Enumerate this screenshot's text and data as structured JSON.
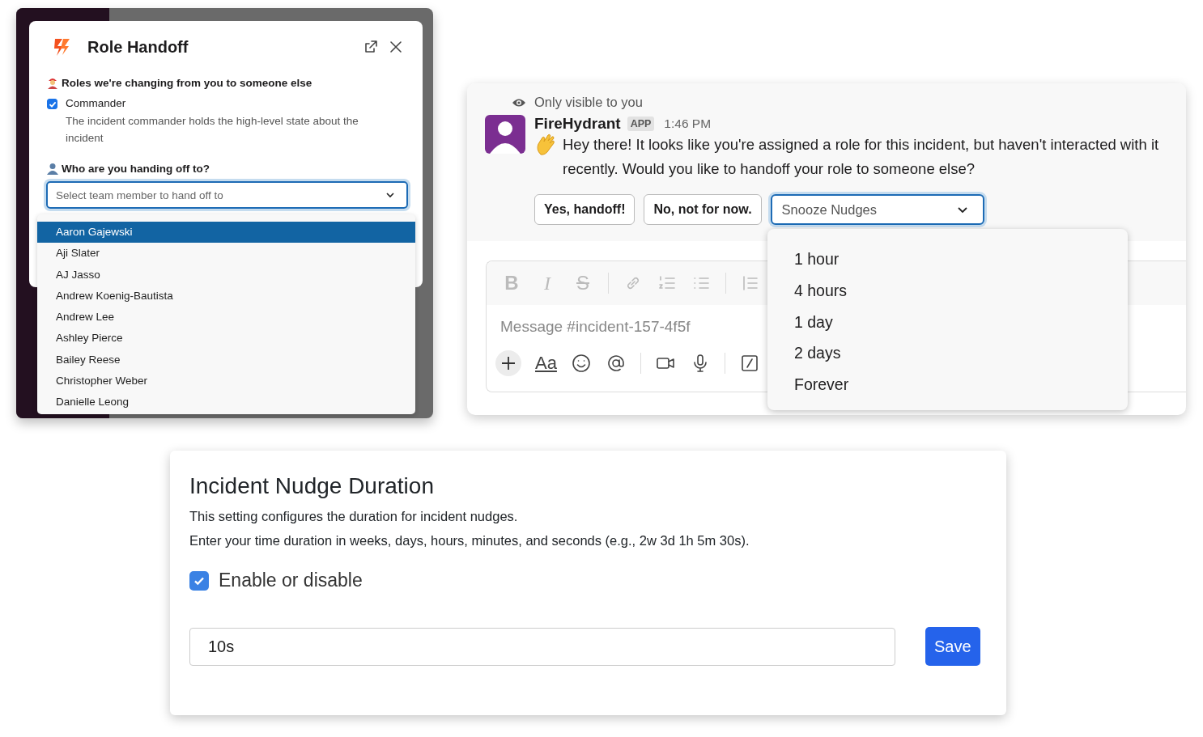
{
  "role_handoff_modal": {
    "title": "Role Handoff",
    "roles_heading": "Roles we're changing from you to someone else",
    "roles": [
      {
        "name": "Commander",
        "description": "The incident commander holds the high-level state about the incident",
        "checked": true
      }
    ],
    "handoff_heading": "Who are you handing off to?",
    "member_select": {
      "placeholder": "Select team member to hand off to",
      "options": [
        {
          "label": "Aaron Gajewski",
          "selected": true
        },
        {
          "label": "Aji Slater",
          "selected": false
        },
        {
          "label": "AJ Jasso",
          "selected": false
        },
        {
          "label": "Andrew Koenig-Bautista",
          "selected": false
        },
        {
          "label": "Andrew Lee",
          "selected": false
        },
        {
          "label": "Ashley Pierce",
          "selected": false
        },
        {
          "label": "Bailey Reese",
          "selected": false
        },
        {
          "label": "Christopher Weber",
          "selected": false
        },
        {
          "label": "Danielle Leong",
          "selected": false
        }
      ]
    }
  },
  "slack_message": {
    "visibility_note": "Only visible to you",
    "sender": "FireHydrant",
    "badge": "APP",
    "time": "1:46 PM",
    "text": "Hey there! It looks like you're assigned a role for this incident, but haven't interacted with it recently. Would you like to handoff your role to someone else?",
    "buttons": [
      "Yes, handoff!",
      "No, not for now."
    ],
    "snooze_select": {
      "placeholder": "Snooze Nudges",
      "options": [
        {
          "label": "1 hour",
          "selected": false
        },
        {
          "label": "4 hours",
          "selected": false
        },
        {
          "label": "1 day",
          "selected": false
        },
        {
          "label": "2 days",
          "selected": false
        },
        {
          "label": "Forever",
          "selected": false
        }
      ]
    },
    "composer": {
      "format_buttons": [
        "B",
        "I",
        "S"
      ],
      "text_format_button": "Aa",
      "placeholder": "Message #incident-157-4f5f"
    }
  },
  "nudge_settings": {
    "title": "Incident Nudge Duration",
    "description": "This setting configures the duration for incident nudges.",
    "hint": "Enter your time duration in weeks, days, hours, minutes, and seconds (e.g., 2w 3d 1h 5m 30s).",
    "enable": {
      "label": "Enable or disable",
      "checked": true
    },
    "duration_field": {
      "value": "10s"
    },
    "save_button": "Save"
  }
}
